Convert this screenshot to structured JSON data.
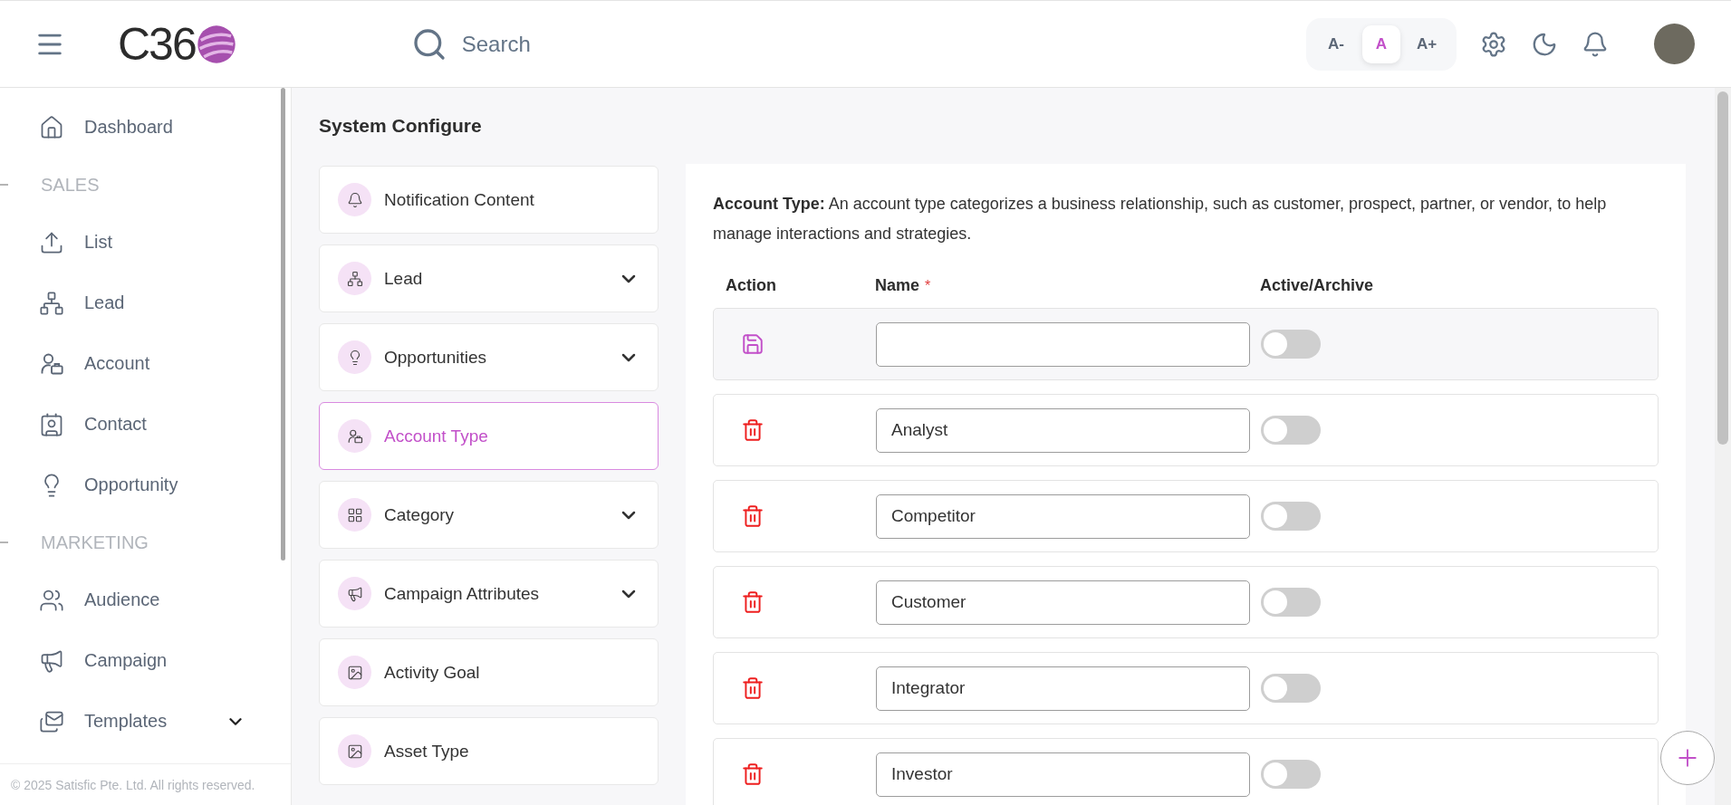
{
  "header": {
    "logo": "C36",
    "search": {
      "placeholder": "Search"
    },
    "font_sizes": [
      {
        "label": "A-",
        "selected": false
      },
      {
        "label": "A",
        "selected": true
      },
      {
        "label": "A+",
        "selected": false
      }
    ]
  },
  "sidebar": {
    "items": [
      {
        "kind": "item",
        "label": "Dashboard",
        "expandable": false
      },
      {
        "kind": "section",
        "label": "SALES"
      },
      {
        "kind": "item",
        "label": "List",
        "expandable": false
      },
      {
        "kind": "item",
        "label": "Lead",
        "expandable": false
      },
      {
        "kind": "item",
        "label": "Account",
        "expandable": false
      },
      {
        "kind": "item",
        "label": "Contact",
        "expandable": false
      },
      {
        "kind": "item",
        "label": "Opportunity",
        "expandable": false
      },
      {
        "kind": "section",
        "label": "MARKETING"
      },
      {
        "kind": "item",
        "label": "Audience",
        "expandable": false
      },
      {
        "kind": "item",
        "label": "Campaign",
        "expandable": false
      },
      {
        "kind": "item",
        "label": "Templates",
        "expandable": true
      }
    ],
    "footer": "© 2025 Satisfic Pte. Ltd. All rights reserved."
  },
  "page_title": "System Configure",
  "config_menu": [
    {
      "label": "Notification Content",
      "expandable": false,
      "selected": false
    },
    {
      "label": "Lead",
      "expandable": true,
      "selected": false
    },
    {
      "label": "Opportunities",
      "expandable": true,
      "selected": false
    },
    {
      "label": "Account Type",
      "expandable": false,
      "selected": true
    },
    {
      "label": "Category",
      "expandable": true,
      "selected": false
    },
    {
      "label": "Campaign Attributes",
      "expandable": true,
      "selected": false
    },
    {
      "label": "Activity Goal",
      "expandable": false,
      "selected": false
    },
    {
      "label": "Asset Type",
      "expandable": false,
      "selected": false
    }
  ],
  "panel": {
    "description": "**Account Type:**  An account type categorizes a business relationship, such as customer, prospect, partner, or vendor, to help manage interactions and strategies.",
    "columns": [
      {
        "label": "Action",
        "required": false
      },
      {
        "label": "Name",
        "required": true
      },
      {
        "label": "Active/Archive",
        "required": false
      }
    ],
    "required_mark": "*",
    "rows": [
      {
        "kind": "new",
        "value": "",
        "on": false
      },
      {
        "kind": "existing",
        "value": "Analyst",
        "on": false
      },
      {
        "kind": "existing",
        "value": "Competitor",
        "on": false
      },
      {
        "kind": "existing",
        "value": "Customer",
        "on": false
      },
      {
        "kind": "existing",
        "value": "Integrator",
        "on": false
      },
      {
        "kind": "existing",
        "value": "Investor",
        "on": false
      }
    ]
  }
}
